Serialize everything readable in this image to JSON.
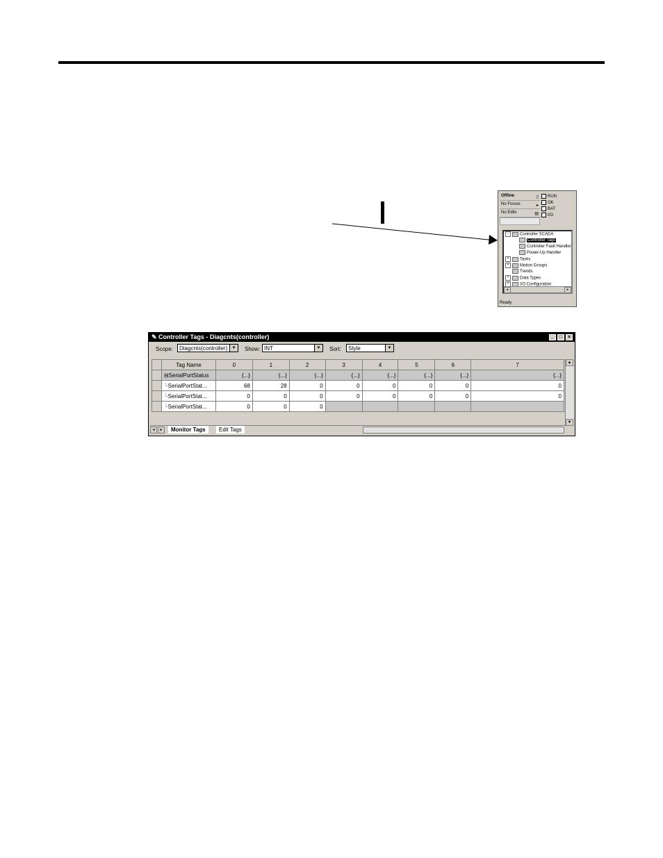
{
  "organizer": {
    "status_rows": [
      {
        "label": "Offline"
      },
      {
        "label": "No Forces"
      },
      {
        "label": "No Edits"
      }
    ],
    "leds": [
      "RUN",
      "OK",
      "BAT",
      "I/O"
    ],
    "tree": [
      {
        "label": "Controller SCADA",
        "expander": "−",
        "indent": 0
      },
      {
        "label": "Controller Tags",
        "indent": 1,
        "selected": true
      },
      {
        "label": "Controller Fault Handler",
        "indent": 1
      },
      {
        "label": "Power-Up Handler",
        "indent": 1
      },
      {
        "label": "Tasks",
        "expander": "+",
        "indent": 0
      },
      {
        "label": "Motion Groups",
        "expander": "+",
        "indent": 0
      },
      {
        "label": "Trends",
        "indent": 0
      },
      {
        "label": "Data Types",
        "expander": "+",
        "indent": 0
      },
      {
        "label": "I/O Configuration",
        "expander": "+",
        "indent": 0
      }
    ],
    "status_bar": "Ready"
  },
  "tag_window": {
    "title": "Controller Tags - Diagcnts(controller)",
    "scope_label": "Scope:",
    "scope_value": "Diagcnts(controller)",
    "show_label": "Show:",
    "show_value": "INT",
    "sort_label": "Sort:",
    "sort_value": "Style",
    "columns": [
      "Tag Name",
      "0",
      "1",
      "2",
      "3",
      "4",
      "5",
      "6",
      "7"
    ],
    "rows": [
      {
        "name": "SerialPortStatus",
        "values": [
          "{...}",
          "{...}",
          "{...}",
          "{...}",
          "{...}",
          "{...}",
          "{...}",
          "{...}"
        ],
        "parent": true
      },
      {
        "name": "SerialPortStat...",
        "values": [
          "68",
          "28",
          "0",
          "0",
          "0",
          "0",
          "0",
          "0"
        ]
      },
      {
        "name": "SerialPortStat...",
        "values": [
          "0",
          "0",
          "0",
          "0",
          "0",
          "0",
          "0",
          "0"
        ]
      },
      {
        "name": "SerialPortStat...",
        "values": [
          "0",
          "0",
          "0",
          "",
          "",
          "",
          "",
          ""
        ]
      }
    ],
    "tabs": [
      "Monitor Tags",
      "Edit Tags"
    ]
  }
}
